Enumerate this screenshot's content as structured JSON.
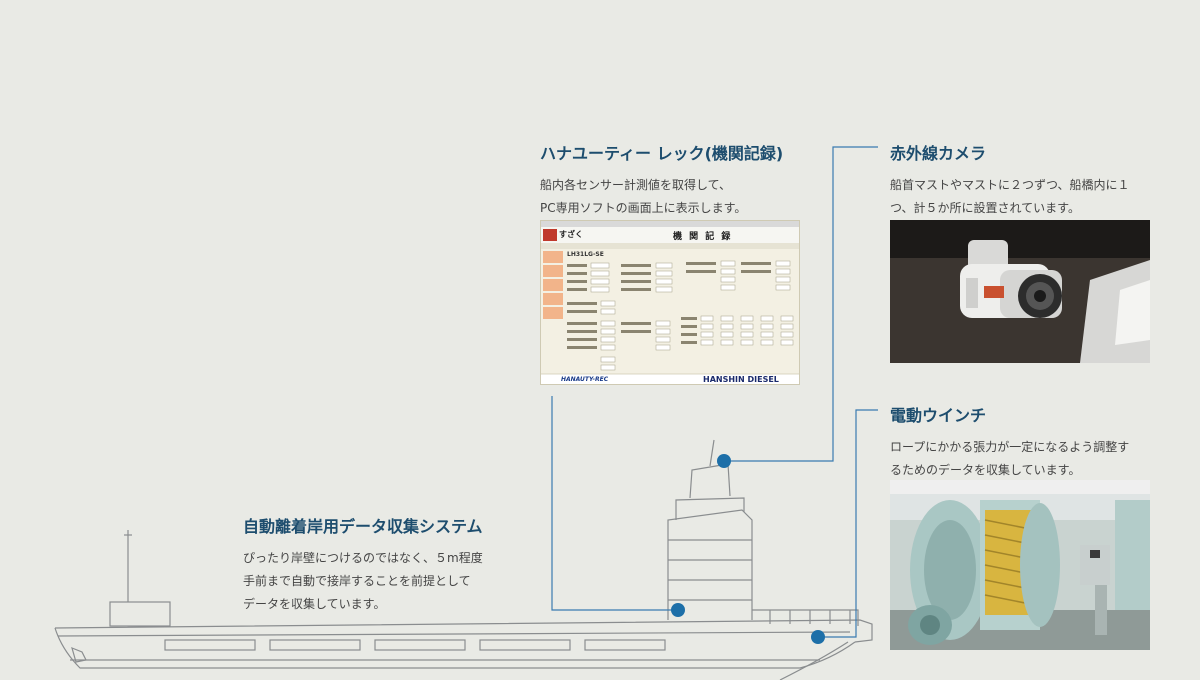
{
  "sections": {
    "hanauty": {
      "title": "ハナユーティー レック(機関記録)",
      "lines": [
        "船内各センサー計測値を取得して、",
        "PC専用ソフトの画面上に表示します。"
      ]
    },
    "camera": {
      "title": "赤外線カメラ",
      "lines": [
        "船首マストやマストに２つずつ、船橋内に１",
        "つ、計５か所に設置されています。"
      ]
    },
    "winch": {
      "title": "電動ウインチ",
      "lines": [
        "ロープにかかる張力が一定になるよう調整す",
        "るためのデータを収集しています。"
      ]
    },
    "berthing": {
      "title": "自動離着岸用データ収集システム",
      "lines": [
        "ぴったり岸壁につけるのではなく、５m程度",
        "手前まで自動で接岸することを前提として",
        "データを収集しています。"
      ]
    }
  },
  "screen": {
    "logo": "すざく",
    "header_title": "機 関 記 録",
    "engine_model": "LH31LG-SE",
    "footer_left": "HANAUTY-REC",
    "footer_right": "HANSHIN DIESEL"
  },
  "colors": {
    "accent": "#1d6fa8",
    "heading": "#1d4d6e",
    "line": "#3a7bb0",
    "background": "#e9eae5"
  }
}
